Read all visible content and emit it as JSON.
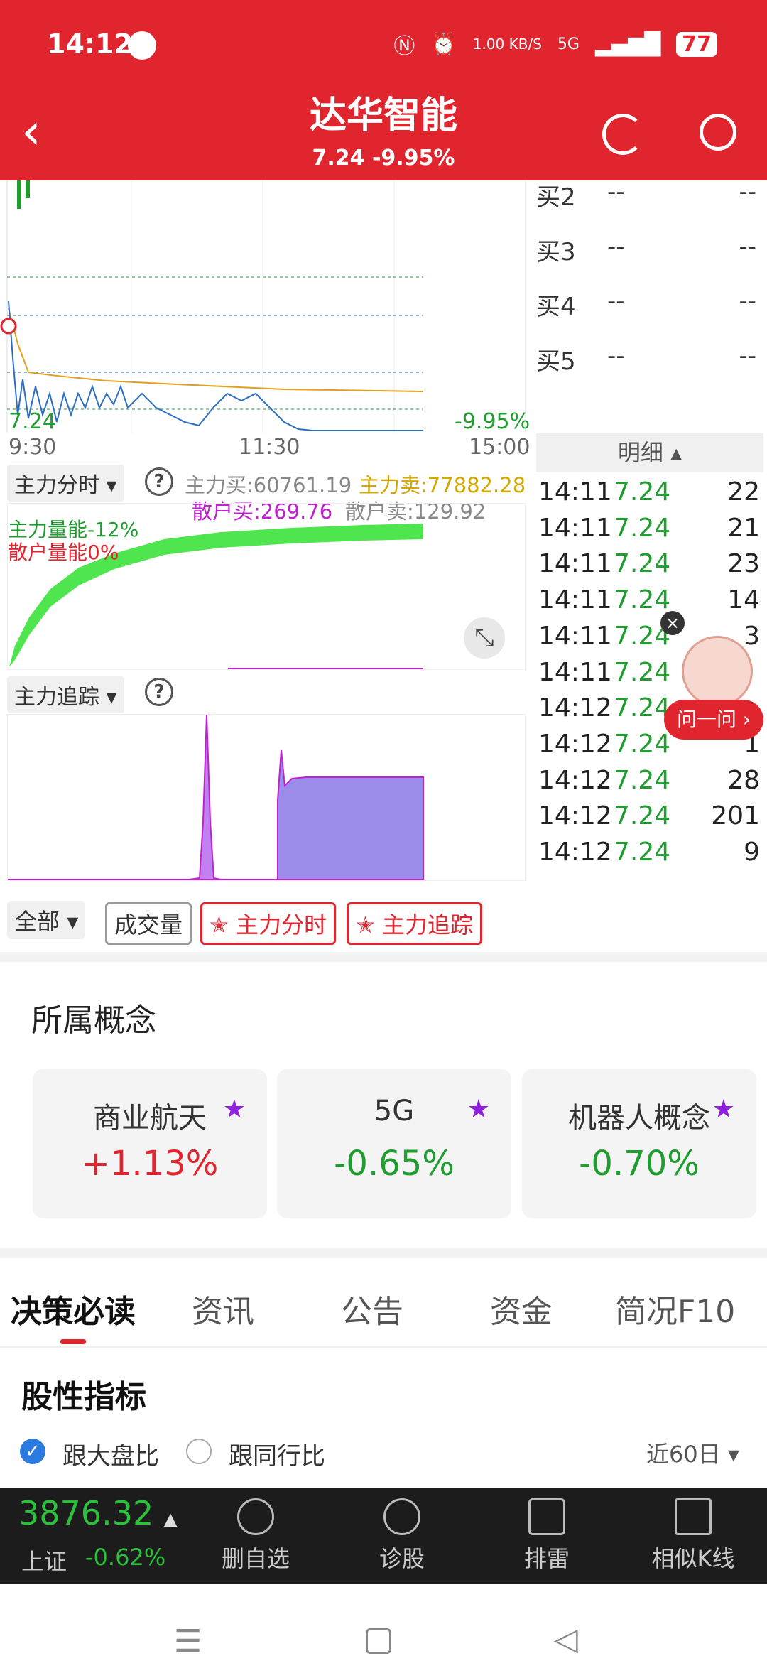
{
  "status_bar": {
    "time": "14:12",
    "speed": "1.00 KB/S",
    "battery": "77",
    "network": "5G"
  },
  "header": {
    "title": "达华智能",
    "price_change": "7.24 -9.95%"
  },
  "chart": {
    "price_label": "7.24",
    "change_label": "-9.95%",
    "times": [
      "9:30",
      "11:30",
      "15:00"
    ]
  },
  "fund_flow": {
    "tab_label": "主力分时",
    "main_buy": "主力买:60761.19",
    "main_sell": "主力卖:77882.28",
    "retail_buy": "散户买:269.76",
    "retail_sell": "散户卖:129.92",
    "main_energy": "主力量能-12%",
    "retail_energy": "散户量能0%"
  },
  "tracking": {
    "tab_label": "主力追踪"
  },
  "order_book": [
    {
      "label": "买2",
      "price": "--",
      "vol": "--"
    },
    {
      "label": "买3",
      "price": "--",
      "vol": "--"
    },
    {
      "label": "买4",
      "price": "--",
      "vol": "--"
    },
    {
      "label": "买5",
      "price": "--",
      "vol": "--"
    }
  ],
  "ticks_header": "明细",
  "ticks": [
    {
      "time": "14:11",
      "price": "7.24",
      "vol": "22"
    },
    {
      "time": "14:11",
      "price": "7.24",
      "vol": "21"
    },
    {
      "time": "14:11",
      "price": "7.24",
      "vol": "23"
    },
    {
      "time": "14:11",
      "price": "7.24",
      "vol": "14"
    },
    {
      "time": "14:11",
      "price": "7.24",
      "vol": "3"
    },
    {
      "time": "14:11",
      "price": "7.24",
      "vol": ""
    },
    {
      "time": "14:12",
      "price": "7.24",
      "vol": ""
    },
    {
      "time": "14:12",
      "price": "7.24",
      "vol": "1"
    },
    {
      "time": "14:12",
      "price": "7.24",
      "vol": "28"
    },
    {
      "time": "14:12",
      "price": "7.24",
      "vol": "201"
    },
    {
      "time": "14:12",
      "price": "7.24",
      "vol": "9"
    }
  ],
  "ask_bubble": "问一问",
  "filters": {
    "all": "全部",
    "volume": "成交量",
    "main_time": "主力分时",
    "main_track": "主力追踪"
  },
  "concepts_title": "所属概念",
  "concepts": [
    {
      "name": "商业航天",
      "change": "+1.13%"
    },
    {
      "name": "5G",
      "change": "-0.65%"
    },
    {
      "name": "机器人概念",
      "change": "-0.70%"
    }
  ],
  "tabs": [
    "决策必读",
    "资讯",
    "公告",
    "资金",
    "简况F10"
  ],
  "indicator": {
    "title": "股性指标",
    "option1": "跟大盘比",
    "option2": "跟同行比",
    "period": "近60日"
  },
  "bottom_bar": {
    "index_value": "3876.32",
    "index_name": "上证",
    "index_change": "-0.62%",
    "items": [
      "删自选",
      "诊股",
      "排雷",
      "相似K线"
    ]
  }
}
